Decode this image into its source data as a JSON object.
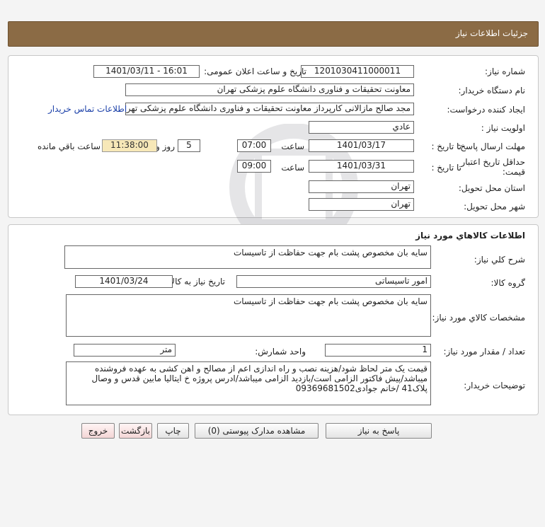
{
  "header": {
    "title": "جزئیات اطلاعات نیاز"
  },
  "info": {
    "need_number_label": "شماره نیاز:",
    "need_number": "1201030411000011",
    "announce_label": "تاریخ و ساعت اعلان عمومی:",
    "announce_value": "1401/03/11 - 16:01",
    "buyer_org_label": "نام دستگاه خریدار:",
    "buyer_org": "معاونت تحقیقات و فناوری دانشگاه علوم پزشکی تهران",
    "requester_label": "ایجاد کننده درخواست:",
    "requester": "مجد صالح مازالانی کارپرداز معاونت تحقیقات و فناوری دانشگاه علوم پزشکی تهران",
    "contact_link": "اطلاعات تماس خریدار",
    "priority_label": "اولویت نیاز :",
    "priority": "عادي",
    "deadline_label": "مهلت ارسال پاسخ:",
    "to_date_label": "تا تاریخ :",
    "deadline_date": "1401/03/17",
    "time_label": "ساعت",
    "deadline_time": "07:00",
    "days_value": "5",
    "days_label": "روز و",
    "remaining_time": "11:38:00",
    "remaining_label": "ساعت باقي مانده",
    "validity_label_1": "حداقل تاریخ اعتبار",
    "validity_label_2": "قیمت:",
    "validity_date": "1401/03/31",
    "validity_time": "09:00",
    "province_label": "استان محل تحویل:",
    "province": "تهران",
    "city_label": "شهر محل تحویل:",
    "city": "تهران"
  },
  "goods": {
    "section_title": "اطلاعات کالاهاي مورد نياز",
    "general_desc_label": "شرح کلي نياز:",
    "general_desc": "سایه بان مخصوص پشت بام جهت حفاظت از تاسیسات",
    "group_label": "گروه کالا:",
    "group": "امور تاسیساتی",
    "need_date_label": "تاریخ نیاز به کالا:",
    "need_date": "1401/03/24",
    "specs_label": "مشخصات کالاي مورد نياز:",
    "specs": "سایه بان مخصوص پشت بام جهت حفاظت از تاسیسات",
    "quantity_label": "تعداد / مقدار مورد نیاز:",
    "quantity": "1",
    "unit_label": "واحد شمارش:",
    "unit": "متر",
    "buyer_notes_label": "توضیحات خریدار:",
    "buyer_notes": "قیمت یک متر لحاظ شود/هزینه نصب و راه اندازی اعم از مصالح و اهن کشی به عهده فروشنده میباشد/پیش فاکتور الزامی است/بازدید الزامی میباشد/ادرس پروژه خ ایتالیا مابین قدس و وصال پلاک41 /خانم جوادی09369681502"
  },
  "buttons": {
    "reply": "پاسخ به نیاز",
    "view_docs": "مشاهده مدارک پیوستی (0)",
    "print": "چاپ",
    "back": "بازگشت",
    "exit": "خروج"
  },
  "colors": {
    "header_bg": "#8b6b45",
    "timer_bg": "#f7e8b8",
    "link": "#1a3fa8"
  }
}
